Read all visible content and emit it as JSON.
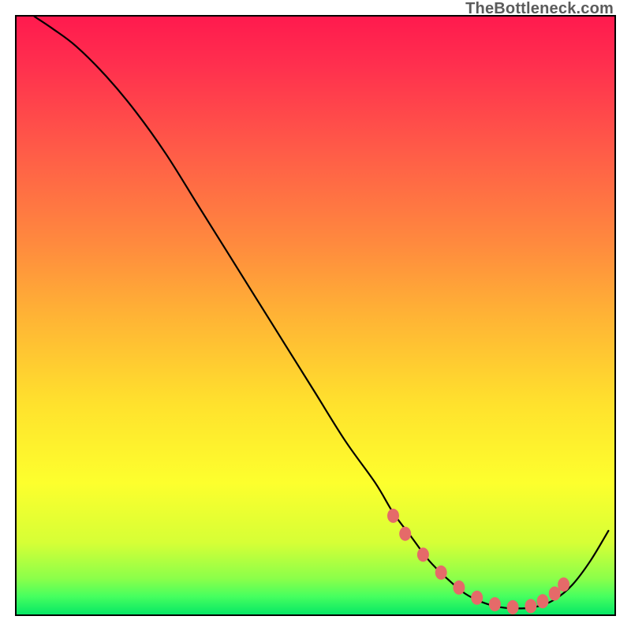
{
  "watermark": "TheBottleneck.com",
  "colors": {
    "curve": "#000000",
    "marker": "#e56a69",
    "border": "#000000"
  },
  "chart_data": {
    "type": "line",
    "title": "",
    "xlabel": "",
    "ylabel": "",
    "xlim": [
      0,
      100
    ],
    "ylim": [
      0,
      100
    ],
    "grid": false,
    "legend": false,
    "series": [
      {
        "name": "bottleneck-curve",
        "x": [
          3,
          6,
          10,
          15,
          20,
          25,
          30,
          35,
          40,
          45,
          50,
          55,
          60,
          63,
          66,
          69,
          72,
          75,
          78,
          81,
          84,
          87,
          90,
          93,
          96,
          99
        ],
        "y": [
          100,
          98,
          95,
          90,
          84,
          77,
          69,
          61,
          53,
          45,
          37,
          29,
          22,
          17,
          13,
          9,
          6,
          3.5,
          2,
          1.2,
          1,
          1.3,
          2.5,
          5,
          9,
          14
        ]
      }
    ],
    "markers": {
      "name": "highlight-points",
      "x": [
        63,
        65,
        68,
        71,
        74,
        77,
        80,
        83,
        86,
        88,
        90,
        91.5
      ],
      "y": [
        16.5,
        13.5,
        10,
        7,
        4.5,
        2.8,
        1.7,
        1.2,
        1.4,
        2.2,
        3.5,
        5
      ]
    }
  }
}
